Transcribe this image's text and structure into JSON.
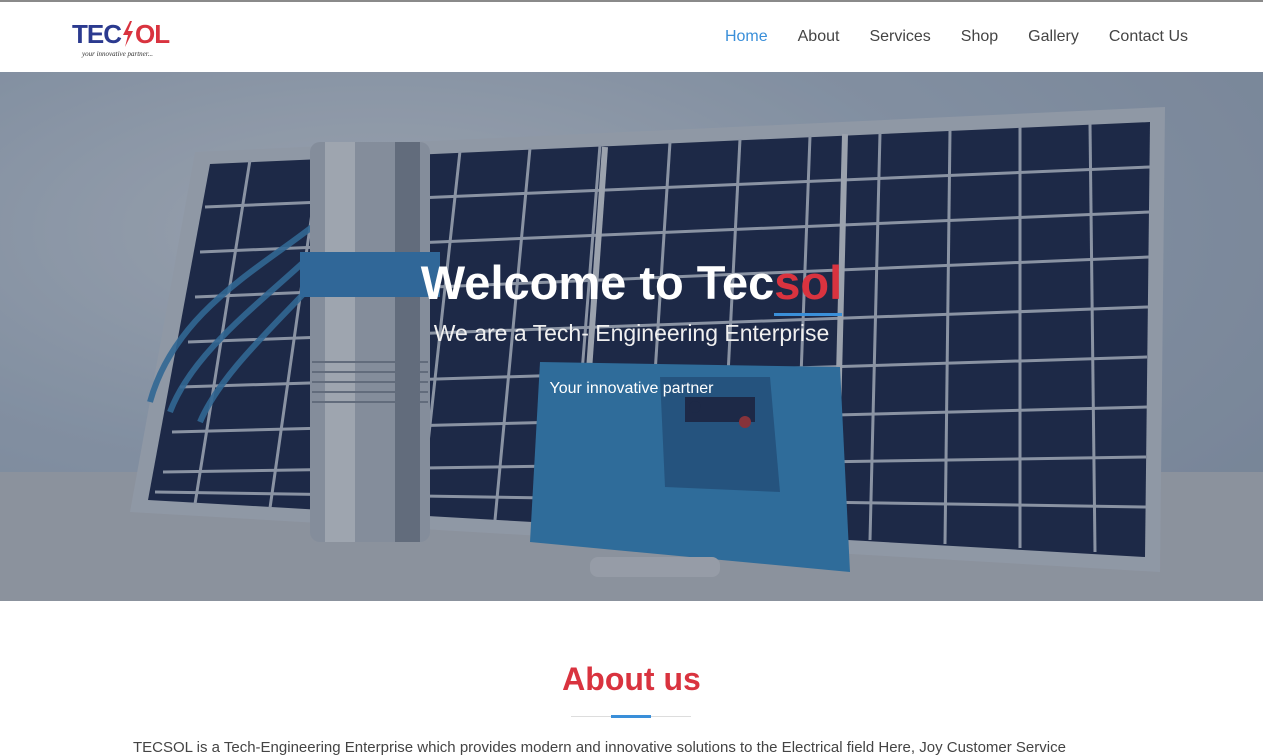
{
  "brand": {
    "logo_left": "TEC",
    "logo_right": "OL",
    "tagline": "your innovative partner..."
  },
  "nav": {
    "items": [
      {
        "label": "Home",
        "active": true
      },
      {
        "label": "About"
      },
      {
        "label": "Services"
      },
      {
        "label": "Shop"
      },
      {
        "label": "Gallery"
      },
      {
        "label": "Contact Us"
      }
    ]
  },
  "hero": {
    "title_prefix": "Welcome to Tec",
    "title_accent": "sol",
    "subtitle": "We are a Tech- Engineering Enterprise",
    "tagline": "Your innovative partner"
  },
  "about": {
    "heading": "About us",
    "text": "TECSOL is a Tech-Engineering Enterprise which provides modern and innovative solutions to the Electrical field Here, Joy Customer Service"
  },
  "colors": {
    "accent_blue": "#3a8fd9",
    "accent_red": "#d9333f",
    "brand_navy": "#2b3a8f"
  }
}
